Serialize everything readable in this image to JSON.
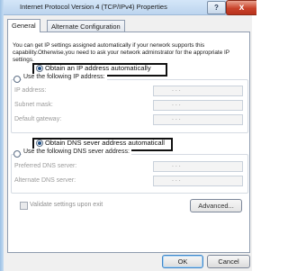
{
  "window": {
    "title": "Internet Protocol Version 4 (TCP/IPv4) Properties",
    "help_label": "?",
    "close_label": "x"
  },
  "tabs": [
    {
      "label": "General",
      "selected": true
    },
    {
      "label": "Alternate Configuration",
      "selected": false
    }
  ],
  "description": "You can get IP settings assigned automatically if your nerwork supports this capability.Otherwise,you need to ask your network adminstrator for the appropriate IP settings.",
  "ip": {
    "auto_label": "Obtain an IP address automatically",
    "manual_label": "Use the following IP address:",
    "auto_selected": true,
    "fields": [
      {
        "label": "IP address:",
        "value": ". . ."
      },
      {
        "label": "Subnet mask:",
        "value": ". . ."
      },
      {
        "label": "Default gateway:",
        "value": ". . ."
      }
    ]
  },
  "dns": {
    "auto_label": "Obtain DNS sever address automaticall",
    "manual_label": "Use the following DNS sever address:",
    "auto_selected": true,
    "fields": [
      {
        "label": "Preferred DNS server:",
        "value": ". . ."
      },
      {
        "label": "Alternate DNS server:",
        "value": ". . ."
      }
    ]
  },
  "validate_label": "Validate settings upon exit",
  "validate_checked": false,
  "buttons": {
    "advanced": "Advanced...",
    "ok": "OK",
    "cancel": "Cancel"
  }
}
